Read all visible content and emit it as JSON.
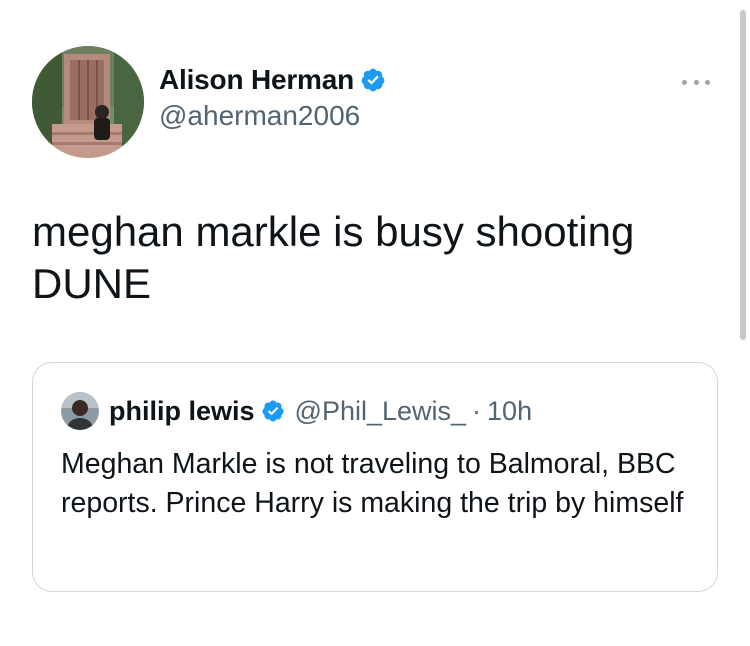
{
  "tweet": {
    "author": {
      "name": "Alison Herman",
      "handle": "@aherman2006",
      "verified_icon": "verified-badge-icon",
      "avatar_icon": "avatar"
    },
    "more_icon": "more-options-icon",
    "text": "meghan markle is busy shooting\nDUNE"
  },
  "quote": {
    "author": {
      "name": "philip lewis",
      "handle": "@Phil_Lewis_",
      "verified_icon": "verified-badge-icon",
      "avatar_icon": "avatar"
    },
    "separator": "·",
    "time": "10h",
    "text": "Meghan Markle is not traveling to Balmoral, BBC reports. Prince Harry is making the trip by himself"
  },
  "colors": {
    "text": "#0f1419",
    "secondary": "#536471",
    "verified": "#1d9bf0",
    "border": "#cfd9de"
  }
}
